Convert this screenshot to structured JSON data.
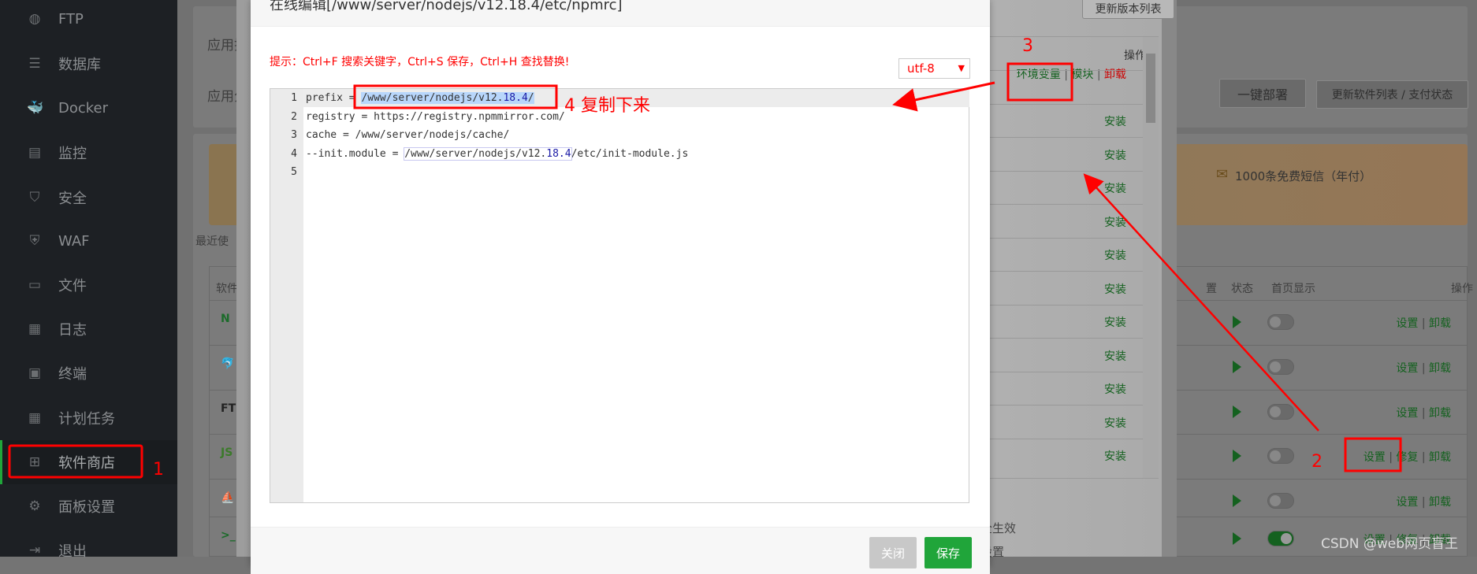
{
  "sidebar": {
    "items": [
      {
        "label": "FTP",
        "icon": "globe-icon"
      },
      {
        "label": "数据库",
        "icon": "database-icon"
      },
      {
        "label": "Docker",
        "icon": "docker-icon"
      },
      {
        "label": "监控",
        "icon": "monitor-icon"
      },
      {
        "label": "安全",
        "icon": "shield-icon"
      },
      {
        "label": "WAF",
        "icon": "waf-icon"
      },
      {
        "label": "文件",
        "icon": "folder-icon"
      },
      {
        "label": "日志",
        "icon": "log-icon"
      },
      {
        "label": "终端",
        "icon": "terminal-icon"
      },
      {
        "label": "计划任务",
        "icon": "calendar-icon"
      },
      {
        "label": "软件商店",
        "icon": "grid-icon",
        "active": true
      },
      {
        "label": "面板设置",
        "icon": "gear-icon"
      },
      {
        "label": "退出",
        "icon": "logout-icon"
      }
    ]
  },
  "store": {
    "search_label": "应用搜",
    "category_label": "应用分",
    "recent_label": "最近使",
    "deploy_button": "一键部署",
    "refresh_button": "更新软件列表 / 支付状态",
    "sms_promo": "1000条免费短信（年付）",
    "table": {
      "col_name": "软件名",
      "col_status": "状态",
      "col_home": "首页显示",
      "col_ops": "操作",
      "partial_col": "置",
      "rows": [
        {
          "icon": "nginx-icon",
          "ops": [
            "设置",
            "卸载"
          ],
          "home": false
        },
        {
          "icon": "mysql-icon",
          "ops": [
            "设置",
            "卸载"
          ],
          "home": false
        },
        {
          "icon": "ftp-icon",
          "ops": [
            "设置",
            "卸载"
          ],
          "home": false
        },
        {
          "icon": "nodejs-icon",
          "ops": [
            "设置",
            "修复",
            "卸载"
          ],
          "home": false
        },
        {
          "icon": "phpmyadmin-icon",
          "ops": [
            "设置",
            "卸载"
          ],
          "home": false
        },
        {
          "icon": "terminal-app-icon",
          "ops": [
            "设置",
            "修复",
            "卸载"
          ],
          "home": true
        }
      ]
    }
  },
  "node_manager": {
    "update_versions_button": "更新版本列表",
    "ops_header": "操作",
    "first_row_ops": [
      "环境变量",
      "模块",
      "卸载"
    ],
    "install_label": "安装",
    "install_count": 11,
    "bottom_text_1": "全生效",
    "bottom_text_2": "设置"
  },
  "editor": {
    "title": "在线编辑[/www/server/nodejs/v12.18.4/etc/npmrc]",
    "hint": "提示：Ctrl+F 搜索关键字，Ctrl+S 保存，Ctrl+H 查找替换!",
    "encoding": "utf-8",
    "lines": [
      {
        "n": "1",
        "pre": "prefix = ",
        "a": "/www/server/nodejs/v12.",
        "b": "18.4",
        "c": "/"
      },
      {
        "n": "2",
        "text": "registry = https://registry.npmmirror.com/"
      },
      {
        "n": "3",
        "text": "cache = /www/server/nodejs/cache/"
      },
      {
        "n": "4",
        "pre": "--init.module = ",
        "a": "/www/server/nodejs/v12.",
        "b": "18.4",
        "c": "/etc/init-module.js"
      },
      {
        "n": "5",
        "text": ""
      }
    ],
    "close_button": "关闭",
    "save_button": "保存"
  },
  "annotations": {
    "step1": "1",
    "step2": "2",
    "step3": "3",
    "step4": "4 复制下来"
  },
  "watermark": "CSDN @web网页盲王",
  "colors": {
    "accent_green": "#20a53a",
    "annotation_red": "#ff0000"
  }
}
